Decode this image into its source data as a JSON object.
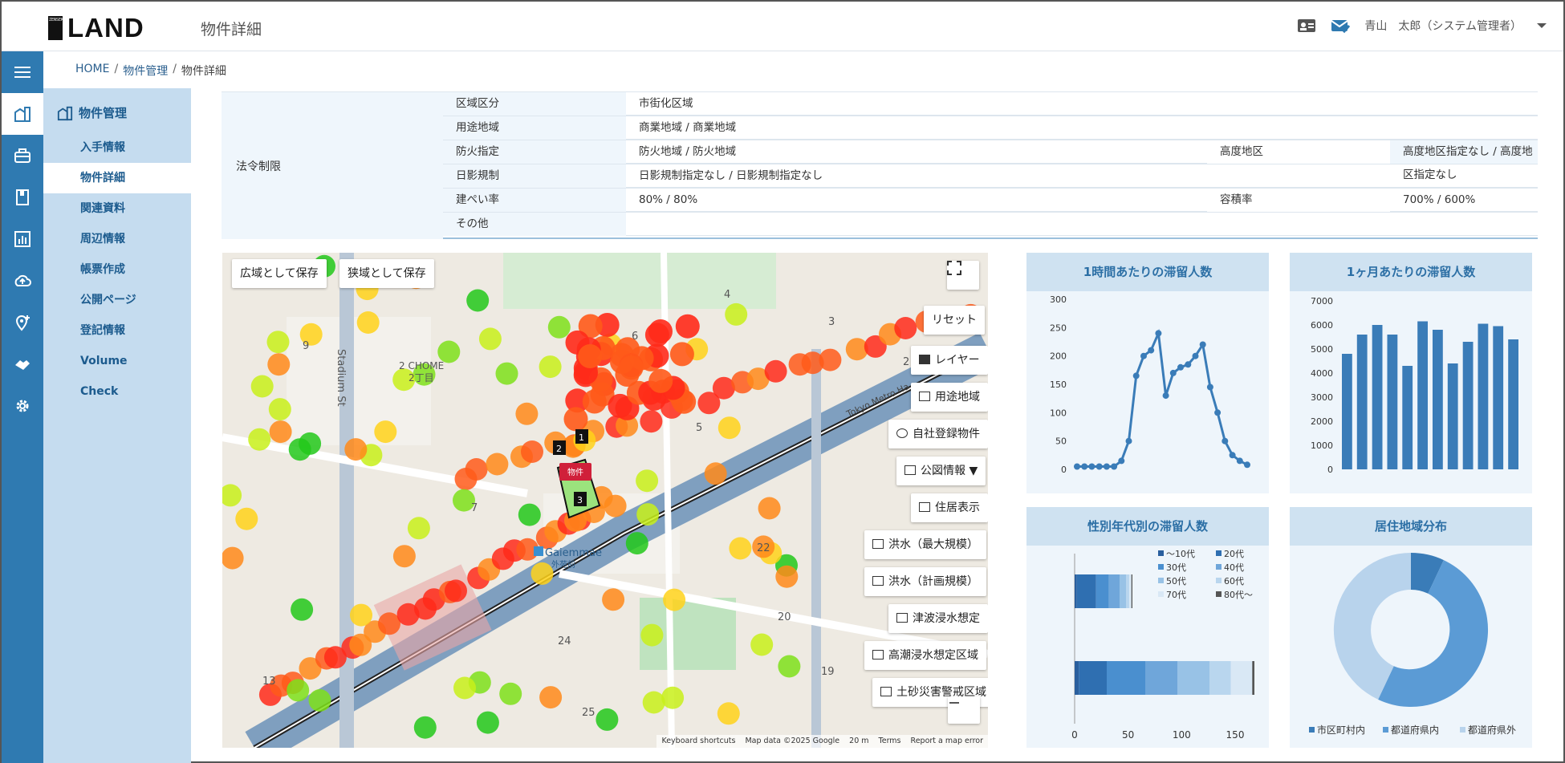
{
  "header": {
    "logo_text": "LAND",
    "logo_mark": "ZENSEKAI",
    "page_title": "物件詳細",
    "user": "青山　太郎（システム管理者）"
  },
  "breadcrumb": [
    "HOME",
    "物件管理",
    "物件詳細"
  ],
  "subnav": {
    "title": "物件管理",
    "items": [
      "入手情報",
      "物件詳細",
      "関連資料",
      "周辺情報",
      "帳票作成",
      "公開ページ",
      "登記情報",
      "Volume Check"
    ],
    "active": 1
  },
  "legal": {
    "head": "法令制限",
    "rows": [
      {
        "key": "区域区分",
        "value": "市街化区域"
      },
      {
        "key": "用途地域",
        "value": "商業地域 / 商業地域"
      },
      {
        "key": "防火指定",
        "value": "防火地域 / 防火地域",
        "key2": "高度地区",
        "value2": "高度地区指定なし / 高度地区指定なし"
      },
      {
        "key": "日影規制",
        "value": "日影規制指定なし / 日影規制指定なし"
      },
      {
        "key": "建ぺい率",
        "value": "80% / 80%",
        "key2": "容積率",
        "value2": "700% / 600%"
      },
      {
        "key": "その他",
        "value": ""
      }
    ]
  },
  "map": {
    "buttons": {
      "save_wide": "広域として保存",
      "save_narrow": "狭域として保存",
      "reset": "リセット",
      "layer": "レイヤー",
      "zoning": "用途地域",
      "own_property": "自社登録物件",
      "cadastral": "公図情報",
      "address": "住居表示",
      "flood_max": "洪水（最大規模）",
      "flood_plan": "洪水（計画規模）",
      "tsunami": "津波浸水想定",
      "storm_surge": "高潮浸水想定区域",
      "landslide": "土砂災害警戒区域"
    },
    "labels": {
      "station_en": "Gaiemmae",
      "station_ja": "外苑前",
      "street": "Stadium St",
      "chome_en": "2 CHOME",
      "chome_ja": "2丁目",
      "metro": "Tokyo Metro Ha",
      "property": "物件",
      "blocks": [
        "4",
        "3",
        "6",
        "9",
        "2",
        "5",
        "7",
        "22",
        "20",
        "24",
        "19",
        "13",
        "25"
      ],
      "lot_markers": [
        "1",
        "2",
        "3"
      ]
    },
    "footer": {
      "shortcuts": "Keyboard shortcuts",
      "data": "Map data ©2025 Google",
      "scale": "20 m",
      "terms": "Terms",
      "report": "Report a map error"
    }
  },
  "charts": {
    "hourly": {
      "title": "1時間あたりの滞留人数",
      "chart_data": {
        "type": "line",
        "ylim": [
          0,
          300
        ],
        "yticks": [
          0,
          50,
          100,
          150,
          200,
          250,
          300
        ],
        "values": [
          5,
          5,
          5,
          5,
          5,
          5,
          15,
          50,
          165,
          200,
          210,
          240,
          130,
          170,
          180,
          185,
          200,
          220,
          145,
          100,
          50,
          25,
          15,
          8
        ],
        "color": "#3a7cb8"
      }
    },
    "monthly": {
      "title": "1ヶ月あたりの滞留人数",
      "chart_data": {
        "type": "bar",
        "ylim": [
          0,
          7000
        ],
        "yticks": [
          0,
          1000,
          2000,
          3000,
          4000,
          5000,
          6000,
          7000
        ],
        "values": [
          4800,
          5600,
          6000,
          5600,
          4300,
          6150,
          5800,
          4400,
          5300,
          6050,
          5950,
          5400
        ],
        "color": "#3a7cb8"
      }
    },
    "age": {
      "title": "性別年代別の滞留人数",
      "chart_data": {
        "type": "bar",
        "orientation": "horizontal",
        "stacked": true,
        "xlim": [
          0,
          150
        ],
        "xticks": [
          0,
          50,
          100,
          150
        ],
        "legend": [
          "〜10代",
          "20代",
          "30代",
          "40代",
          "50代",
          "60代",
          "70代",
          "80代〜"
        ],
        "colors": [
          "#2a5f9e",
          "#2f6fb1",
          "#4a8fcf",
          "#6fa6da",
          "#98c2e6",
          "#b9d6ee",
          "#d9e8f5",
          "#555555"
        ],
        "series": [
          {
            "values": [
              2,
              18,
              12,
              10,
              6,
              3,
              2,
              1
            ]
          },
          {
            "values": [
              4,
              26,
              36,
              30,
              30,
              20,
              20,
              2
            ]
          }
        ]
      }
    },
    "residence": {
      "title": "居住地域分布",
      "chart_data": {
        "type": "pie",
        "donut": true,
        "categories": [
          "市区町村内",
          "都道府県内",
          "都道府県外"
        ],
        "values": [
          7,
          50,
          43
        ],
        "colors": [
          "#3a7cb8",
          "#5b9bd5",
          "#b8d3ec"
        ]
      }
    }
  }
}
